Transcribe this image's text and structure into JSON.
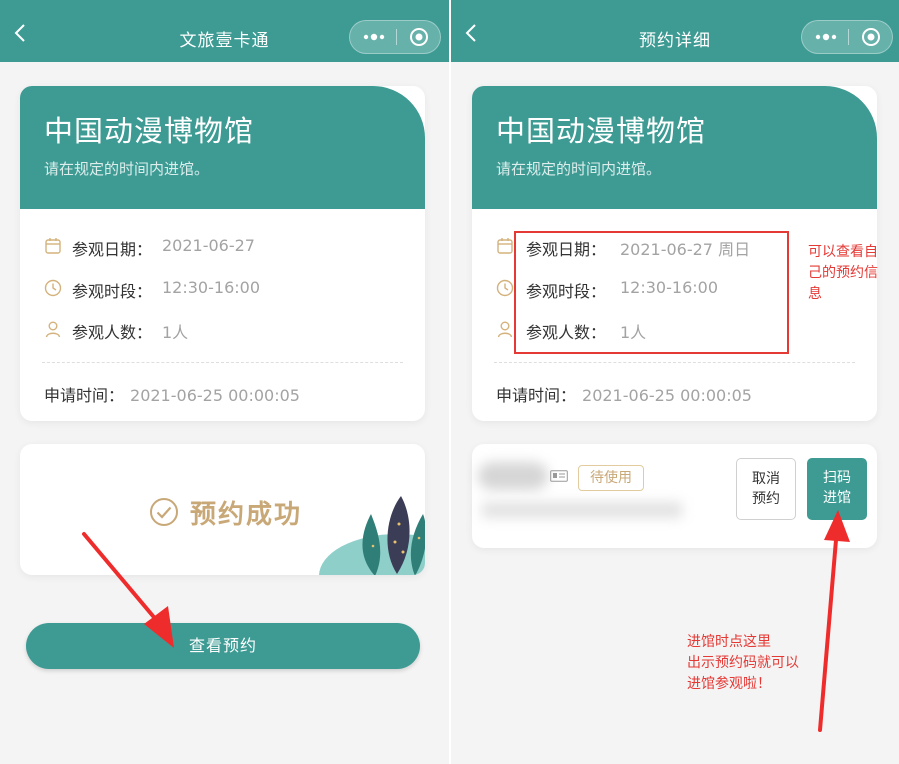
{
  "left": {
    "nav_title": "文旅壹卡通",
    "museum": "中国动漫博物馆",
    "notice": "请在规定的时间内进馆。",
    "visit_date_label": "参观日期：",
    "visit_date": "2021-06-27",
    "time_slot_label": "参观时段：",
    "time_slot": "12:30-16:00",
    "visitors_label": "参观人数：",
    "visitors": "1人",
    "apply_label": "申请时间：",
    "apply_time": "2021-06-25 00:00:05",
    "success": "预约成功",
    "view_button": "查看预约"
  },
  "right": {
    "nav_title": "预约详细",
    "museum": "中国动漫博物馆",
    "notice": "请在规定的时间内进馆。",
    "visit_date_label": "参观日期：",
    "visit_date": "2021-06-27 周日",
    "time_slot_label": "参观时段：",
    "time_slot": "12:30-16:00",
    "visitors_label": "参观人数：",
    "visitors": "1人",
    "apply_label": "申请时间：",
    "apply_time": "2021-06-25 00:00:05",
    "status": "待使用",
    "cancel_line1": "取消",
    "cancel_line2": "预约",
    "scan_line1": "扫码",
    "scan_line2": "进馆"
  },
  "annotations": {
    "note1_line1": "可以查看自",
    "note1_line2": "己的预约信",
    "note1_line3": "息",
    "note2_line1": "进馆时点这里",
    "note2_line2": "出示预约码就可以",
    "note2_line3": "进馆参观啦！"
  },
  "colors": {
    "teal": "#3d9b94",
    "gold": "#c9a878",
    "annotation_red": "#e53935"
  },
  "icons": [
    "back-icon",
    "more-icon",
    "close-circle-icon",
    "calendar-icon",
    "clock-icon",
    "person-icon",
    "check-circle-icon",
    "id-card-icon"
  ]
}
